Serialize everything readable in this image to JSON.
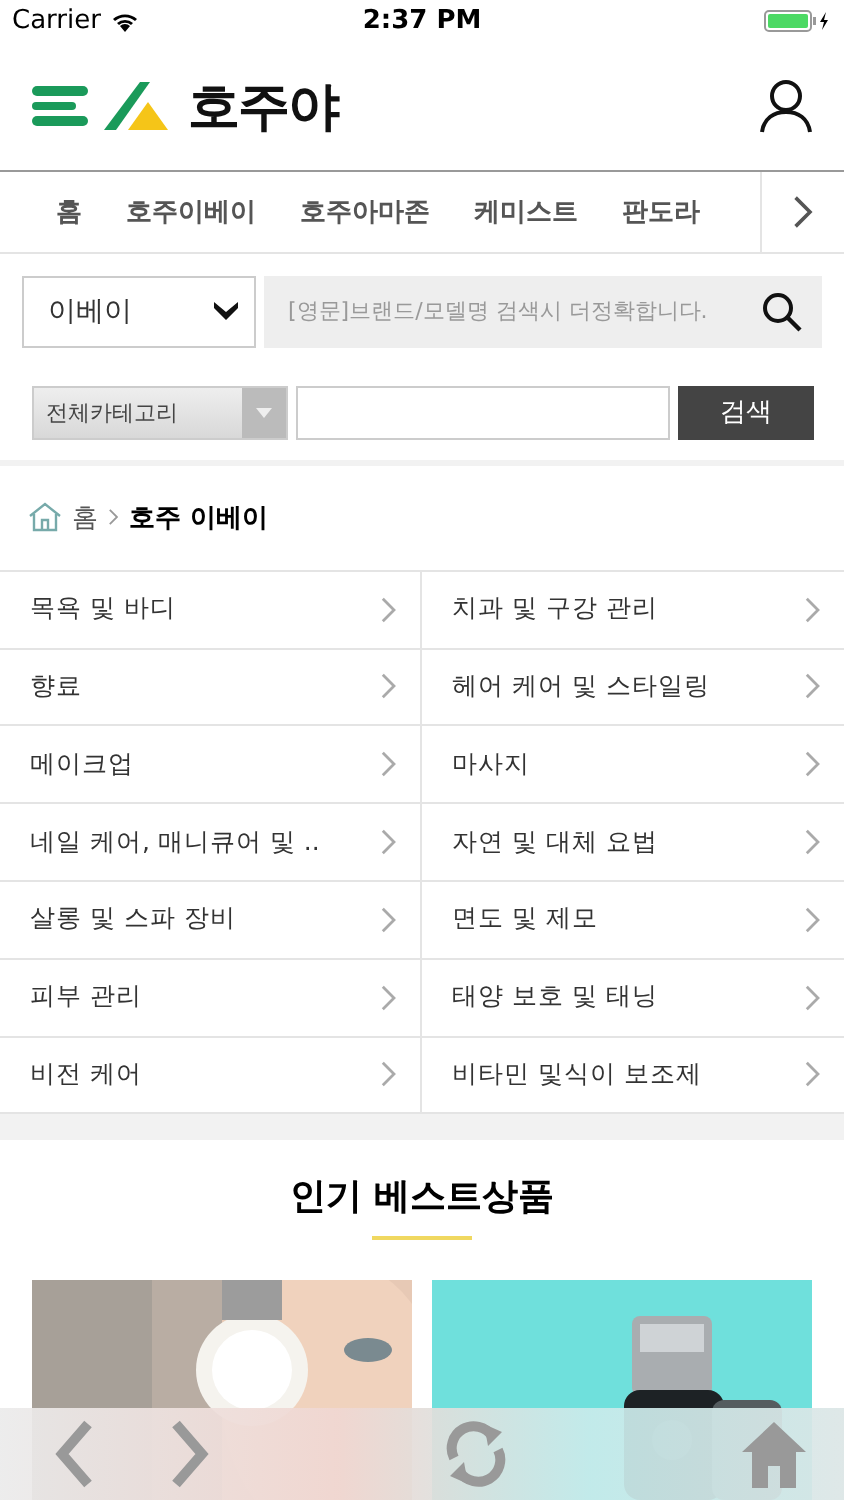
{
  "status_bar": {
    "carrier": "Carrier",
    "time": "2:37 PM"
  },
  "header": {
    "logo_text": "호주야"
  },
  "nav": {
    "tabs": [
      {
        "label": "홈",
        "selected": false
      },
      {
        "label": "호주이베이",
        "selected": false
      },
      {
        "label": "호주아마존",
        "selected": false
      },
      {
        "label": "케미스트",
        "selected": false
      },
      {
        "label": "판도라",
        "selected": false
      }
    ]
  },
  "search": {
    "store": "이베이",
    "placeholder": "[영문]브랜드/모델명 검색시 더정확합니다."
  },
  "category_search": {
    "category": "전체카테고리",
    "button": "검색"
  },
  "breadcrumb": {
    "home": "홈",
    "current": "호주 이베이"
  },
  "categories": [
    {
      "label": "목욕 및 바디"
    },
    {
      "label": "치과 및 구강 관리"
    },
    {
      "label": "향료"
    },
    {
      "label": "헤어 케어 및 스타일링"
    },
    {
      "label": "메이크업"
    },
    {
      "label": "마사지"
    },
    {
      "label": "네일 케어, 매니큐어 및 .."
    },
    {
      "label": "자연 및 대체 요법"
    },
    {
      "label": "살롱 및 스파 장비"
    },
    {
      "label": "면도 및 제모"
    },
    {
      "label": "피부 관리"
    },
    {
      "label": "태양 보호 및 태닝"
    },
    {
      "label": "비전 케어"
    },
    {
      "label": "비타민 및식이 보조제"
    }
  ],
  "best": {
    "title": "인기 베스트상품"
  }
}
